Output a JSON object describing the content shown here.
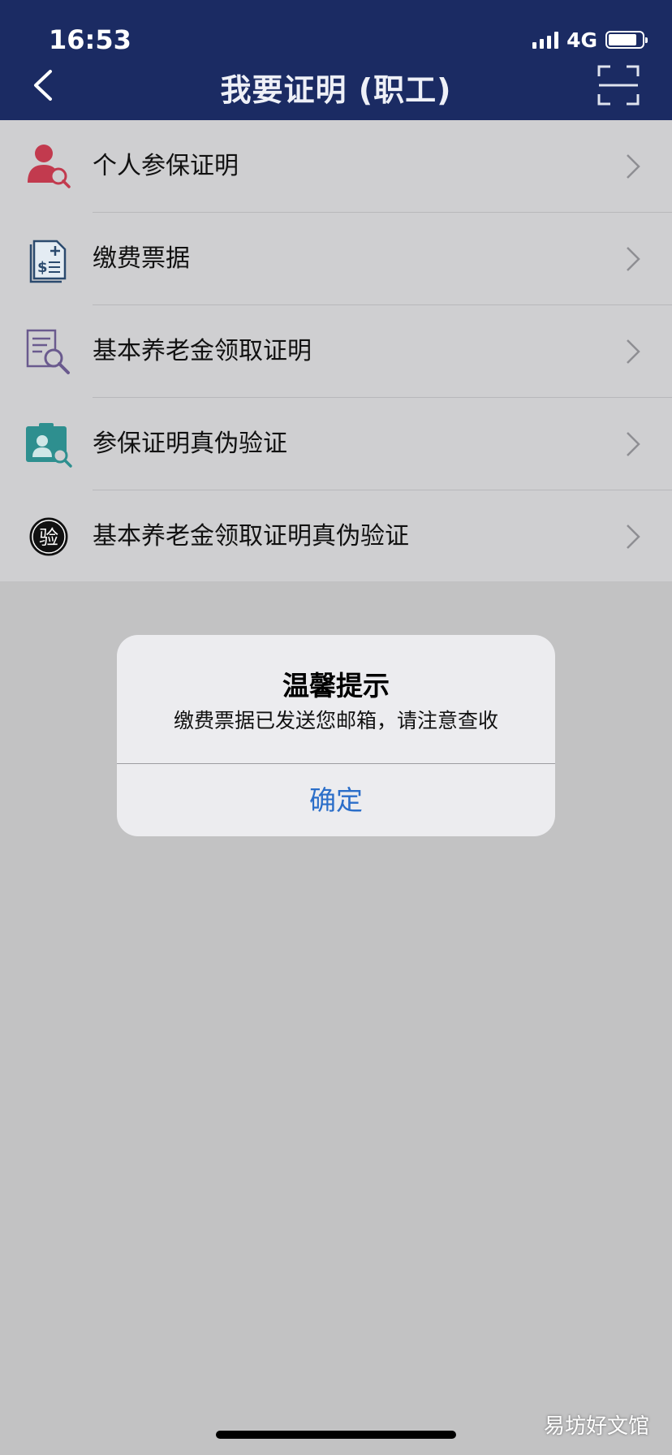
{
  "status_bar": {
    "time": "16:53",
    "network": "4G"
  },
  "nav": {
    "title": "我要证明 (职工)"
  },
  "menu": [
    {
      "label": "个人参保证明",
      "icon": "person-search-icon"
    },
    {
      "label": "缴费票据",
      "icon": "receipt-icon"
    },
    {
      "label": "基本养老金领取证明",
      "icon": "document-search-icon"
    },
    {
      "label": "参保证明真伪验证",
      "icon": "id-card-search-icon"
    },
    {
      "label": "基本养老金领取证明真伪验证",
      "icon": "verify-badge-icon",
      "icon_text": "验"
    }
  ],
  "dialog": {
    "title": "温馨提示",
    "message": "缴费票据已发送您邮箱，请注意查收",
    "confirm_label": "确定"
  },
  "watermark": "易坊好文馆",
  "colors": {
    "nav_bg": "#1b2b63",
    "accent_blue": "#2b6ec9",
    "icon_red": "#c23a4e",
    "icon_teal": "#2e8f8f",
    "icon_purple": "#6a5a8e"
  }
}
